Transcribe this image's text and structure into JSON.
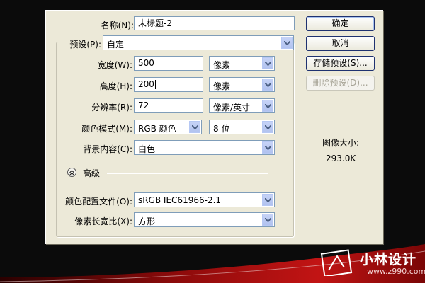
{
  "dialog": {
    "name_label": "名称(N):",
    "name_value": "未标题-2",
    "preset_label": "预设(P):",
    "preset_value": "自定",
    "width_label": "宽度(W):",
    "width_value": "500",
    "width_unit": "像素",
    "height_label": "高度(H):",
    "height_value": "200",
    "height_unit": "像素",
    "resolution_label": "分辨率(R):",
    "resolution_value": "72",
    "resolution_unit": "像素/英寸",
    "color_mode_label": "颜色模式(M):",
    "color_mode_value": "RGB 颜色",
    "bit_depth_value": "8 位",
    "background_label": "背景内容(C):",
    "background_value": "白色",
    "advanced_label": "高级",
    "color_profile_label": "颜色配置文件(O):",
    "color_profile_value": "sRGB IEC61966-2.1",
    "pixel_aspect_label": "像素长宽比(X):",
    "pixel_aspect_value": "方形"
  },
  "buttons": {
    "ok": "确定",
    "cancel": "取消",
    "save_preset": "存储预设(S)...",
    "delete_preset": "删除预设(D)..."
  },
  "image_size": {
    "label": "图像大小:",
    "value": "293.0K"
  },
  "watermark": {
    "brand": "小林设计",
    "url": "www.z990.com"
  }
}
